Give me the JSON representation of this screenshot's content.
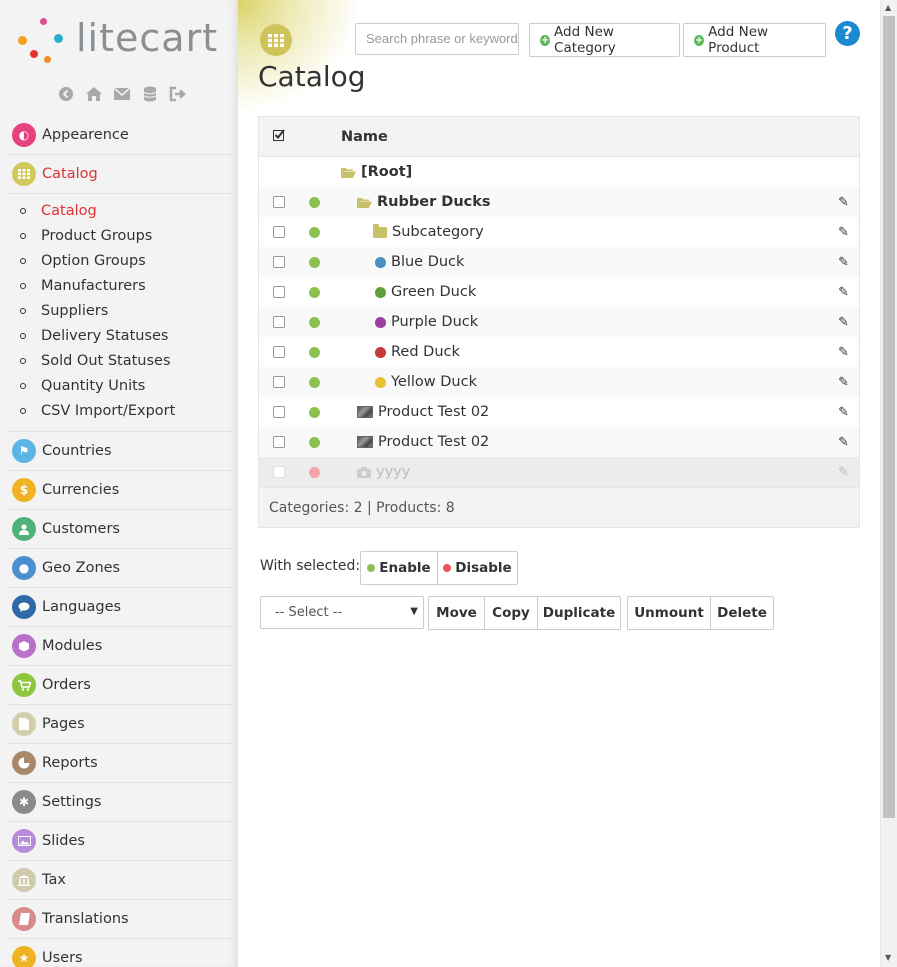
{
  "logo": {
    "text": "litecart"
  },
  "quick_icons": [
    "back-icon",
    "home-icon",
    "mail-icon",
    "database-icon",
    "logout-icon"
  ],
  "nav": {
    "items": [
      {
        "label": "Appearence",
        "icon": "appearance-icon",
        "color": "#e8417f"
      },
      {
        "label": "Catalog",
        "icon": "catalog-icon",
        "color": "#d0c85b",
        "active": true
      },
      {
        "label": "Countries",
        "icon": "flag-icon",
        "color": "#5bb4e5"
      },
      {
        "label": "Currencies",
        "icon": "money-icon",
        "color": "#f0b323"
      },
      {
        "label": "Customers",
        "icon": "user-icon",
        "color": "#4fb07a"
      },
      {
        "label": "Geo Zones",
        "icon": "globe-icon",
        "color": "#4a90d0"
      },
      {
        "label": "Languages",
        "icon": "chat-icon",
        "color": "#2f6aa8"
      },
      {
        "label": "Modules",
        "icon": "cube-icon",
        "color": "#b970c9"
      },
      {
        "label": "Orders",
        "icon": "cart-icon",
        "color": "#8dc63f"
      },
      {
        "label": "Pages",
        "icon": "page-icon",
        "color": "#d3ceaa"
      },
      {
        "label": "Reports",
        "icon": "pie-icon",
        "color": "#a8876b"
      },
      {
        "label": "Settings",
        "icon": "cogs-icon",
        "color": "#8a8a8a"
      },
      {
        "label": "Slides",
        "icon": "image-icon",
        "color": "#b78bd9"
      },
      {
        "label": "Tax",
        "icon": "bank-icon",
        "color": "#cfcaaa"
      },
      {
        "label": "Translations",
        "icon": "book-icon",
        "color": "#d98a8a"
      },
      {
        "label": "Users",
        "icon": "star-icon",
        "color": "#f0b323"
      }
    ],
    "catalog_sub": [
      {
        "label": "Catalog",
        "active": true
      },
      {
        "label": "Product Groups"
      },
      {
        "label": "Option Groups"
      },
      {
        "label": "Manufacturers"
      },
      {
        "label": "Suppliers"
      },
      {
        "label": "Delivery Statuses"
      },
      {
        "label": "Sold Out Statuses"
      },
      {
        "label": "Quantity Units"
      },
      {
        "label": "CSV Import/Export"
      }
    ]
  },
  "header": {
    "title": "Catalog",
    "search_placeholder": "Search phrase or keyword",
    "add_category": "Add New Category",
    "add_product": "Add New Product",
    "help": "?"
  },
  "table": {
    "col_name": "Name",
    "root_label": "[Root]",
    "rows": [
      {
        "name": "Rubber Ducks",
        "type": "folder-open",
        "bold": true,
        "status": "enabled"
      },
      {
        "name": "Subcategory",
        "type": "folder",
        "status": "enabled"
      },
      {
        "name": "Blue Duck",
        "type": "duck",
        "duck_color": "#4a8fbf",
        "status": "enabled"
      },
      {
        "name": "Green Duck",
        "type": "duck",
        "duck_color": "#5fa03b",
        "status": "enabled"
      },
      {
        "name": "Purple Duck",
        "type": "duck",
        "duck_color": "#9b3fa0",
        "status": "enabled"
      },
      {
        "name": "Red Duck",
        "type": "duck",
        "duck_color": "#c83a3a",
        "status": "enabled"
      },
      {
        "name": "Yellow Duck",
        "type": "duck",
        "duck_color": "#e8c030",
        "status": "enabled"
      },
      {
        "name": "Product Test 02",
        "type": "thumb",
        "status": "enabled"
      },
      {
        "name": "Product Test 02",
        "type": "thumb",
        "status": "enabled"
      },
      {
        "name": "yyyy",
        "type": "camera",
        "status": "disabled"
      }
    ],
    "footer": "Categories: 2 | Products: 8"
  },
  "actions": {
    "with_selected": "With selected:",
    "enable": "Enable",
    "disable": "Disable",
    "select_value": "-- Select --",
    "move": "Move",
    "copy": "Copy",
    "duplicate": "Duplicate",
    "unmount": "Unmount",
    "delete": "Delete"
  },
  "colors": {
    "enabled": "#8cc152",
    "disabled": "#ed5565",
    "accent": "#d33333"
  }
}
